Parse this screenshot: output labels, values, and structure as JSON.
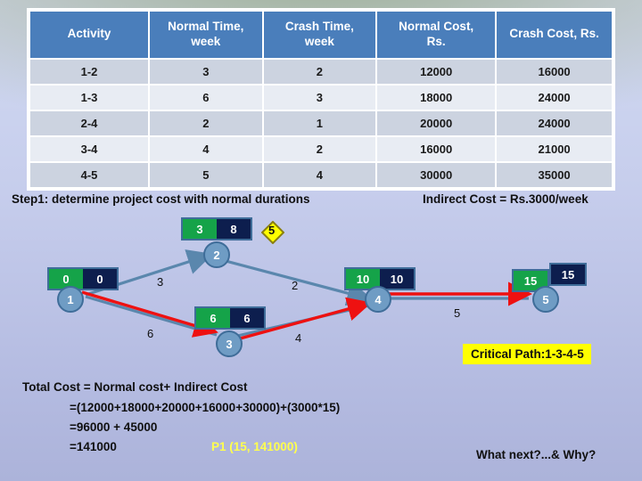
{
  "table": {
    "headers": [
      "Activity",
      "Normal Time, week",
      "Crash Time, week",
      "Normal Cost, Rs.",
      "Crash Cost, Rs."
    ],
    "headers_lines": [
      [
        "Activity"
      ],
      [
        "Normal Time,",
        "week"
      ],
      [
        "Crash Time,",
        "week"
      ],
      [
        "Normal Cost,",
        "Rs."
      ],
      [
        "Crash Cost, Rs."
      ]
    ],
    "rows": [
      [
        "1-2",
        "3",
        "2",
        "12000",
        "16000"
      ],
      [
        "1-3",
        "6",
        "3",
        "18000",
        "24000"
      ],
      [
        "2-4",
        "2",
        "1",
        "20000",
        "24000"
      ],
      [
        "3-4",
        "4",
        "2",
        "16000",
        "21000"
      ],
      [
        "4-5",
        "5",
        "4",
        "30000",
        "35000"
      ]
    ]
  },
  "headings": {
    "step1": "Step1: determine project cost with normal durations",
    "indirect_cost": "Indirect Cost = Rs.3000/week"
  },
  "network": {
    "nodes": [
      {
        "id": "1",
        "label": "1",
        "early": "0",
        "late": "0"
      },
      {
        "id": "2",
        "label": "2",
        "early": "3",
        "late": "8"
      },
      {
        "id": "3",
        "label": "3",
        "early": "6",
        "late": "6"
      },
      {
        "id": "4",
        "label": "4",
        "early": "10",
        "late": "10"
      },
      {
        "id": "5",
        "label": "5",
        "early": "15",
        "late": "15"
      }
    ],
    "edges": [
      {
        "from": "1",
        "to": "2",
        "duration": "3",
        "critical": false
      },
      {
        "from": "1",
        "to": "3",
        "duration": "6",
        "critical": true
      },
      {
        "from": "2",
        "to": "4",
        "duration": "2",
        "critical": false
      },
      {
        "from": "3",
        "to": "4",
        "duration": "4",
        "critical": true
      },
      {
        "from": "4",
        "to": "5",
        "duration": "5",
        "critical": true
      }
    ],
    "slack_marker": "5"
  },
  "critical_path": "Critical Path:1-3-4-5",
  "calc": {
    "line0": "Total Cost = Normal cost+ Indirect Cost",
    "line1": "=(12000+18000+20000+16000+30000)+(3000*15)",
    "line2": "=96000 + 45000",
    "line3": "=141000",
    "p1": "P1 (15, 141000)"
  },
  "what_next": "What next?...&  Why?",
  "colors": {
    "header_blue": "#4a7ebb",
    "row_odd": "#ccd3e0",
    "row_even": "#e8ecf3",
    "node_fill": "#6f9cc4",
    "node_stroke": "#3f6d99",
    "early_green": "#15a349",
    "late_navy": "#0d1e4e",
    "critical_red": "#ee1111",
    "normal_edge": "#5a87ad",
    "highlight_yellow": "#ffff00",
    "p1_yellow": "#ffff4d"
  }
}
